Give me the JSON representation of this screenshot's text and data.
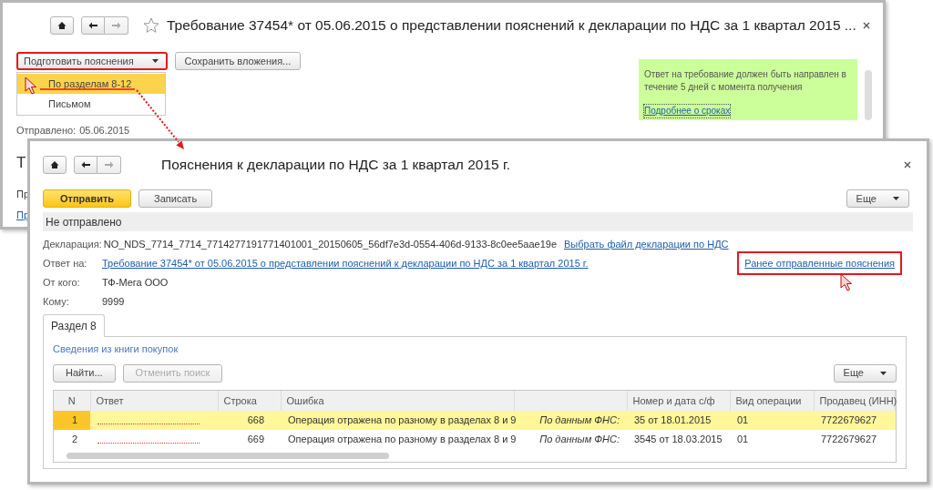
{
  "back_window": {
    "title": "Требование 37454* от 05.06.2015 о представлении пояснений к декларации по НДС за 1 квартал 2015 ...",
    "commands": [
      {
        "label": "Подготовить пояснения",
        "kind": "dropdown",
        "highlighted": true
      },
      {
        "label": "Сохранить вложения...",
        "kind": "button",
        "highlighted": false
      }
    ],
    "menu": [
      {
        "label": "По разделам 8-12",
        "selected": true
      },
      {
        "label": "Письмом",
        "selected": false
      }
    ],
    "sent": {
      "label": "Отправлено:",
      "value": "05.06.2015"
    },
    "partial_texts": [
      {
        "text": "Т",
        "kind": "heading"
      },
      {
        "text": "Пр",
        "kind": "text"
      },
      {
        "text": "Пр",
        "kind": "link"
      }
    ],
    "notice": {
      "text": "Ответ на требование должен быть направлен в течение 5 дней с момента получения",
      "link": "Подробнее о сроках"
    }
  },
  "front_window": {
    "title": "Пояснения к декларации по НДС за 1 квартал 2015 г.",
    "commands": [
      {
        "label": "Отправить",
        "kind": "primary"
      },
      {
        "label": "Записать",
        "kind": "default"
      }
    ],
    "more": "Еще",
    "status": "Не отправлено",
    "fields": [
      {
        "label": "Декларация:",
        "value": "NO_NDS_7714_7714_7714277191771401001_20150605_56df7e3d-0554-406d-9133-8c0ee5aae19e",
        "kind": "text",
        "action": {
          "label": "Выбрать файл декларации по НДС",
          "highlighted": false
        }
      },
      {
        "label": "Ответ на:",
        "value": "Требование 37454* от 05.06.2015 о представлении пояснений к декларации по НДС за 1 квартал 2015 г.",
        "kind": "link",
        "aside": {
          "label": "Ранее отправленные пояснения",
          "highlighted": true
        }
      },
      {
        "label": "От кого:",
        "value": "ТФ-Мега ООО",
        "kind": "text"
      },
      {
        "label": "Кому:",
        "value": "9999",
        "kind": "text"
      }
    ],
    "tabs": [
      {
        "label": "Раздел 8",
        "selected": true
      }
    ],
    "section_title": "Сведения из книги покупок",
    "search_buttons": [
      {
        "label": "Найти...",
        "disabled": false
      },
      {
        "label": "Отменить поиск",
        "disabled": true
      }
    ],
    "table_more": "Еще",
    "table": {
      "columns": [
        {
          "label": "N"
        },
        {
          "label": "Ответ"
        },
        {
          "label": "Строка"
        },
        {
          "label": "Ошибка"
        },
        {},
        {
          "label": "Номер и дата с/ф"
        },
        {
          "label": "Вид операции"
        },
        {
          "label": "Продавец (ИНН)"
        }
      ],
      "rows": [
        {
          "n": "1",
          "line": "668",
          "error": "Операция отражена по разному в разделах 8 и 9",
          "note": "По данным ФНС:",
          "invoice": "35 от 18.01.2015",
          "operation": "01",
          "seller": "7722679627",
          "selected": true
        },
        {
          "n": "2",
          "line": "669",
          "error": "Операция отражена по разному в разделах 8 и 9",
          "note": "По данным ФНС:",
          "invoice": "3545 от 18.03.2015",
          "operation": "01",
          "seller": "7722679627",
          "selected": false
        }
      ]
    }
  }
}
